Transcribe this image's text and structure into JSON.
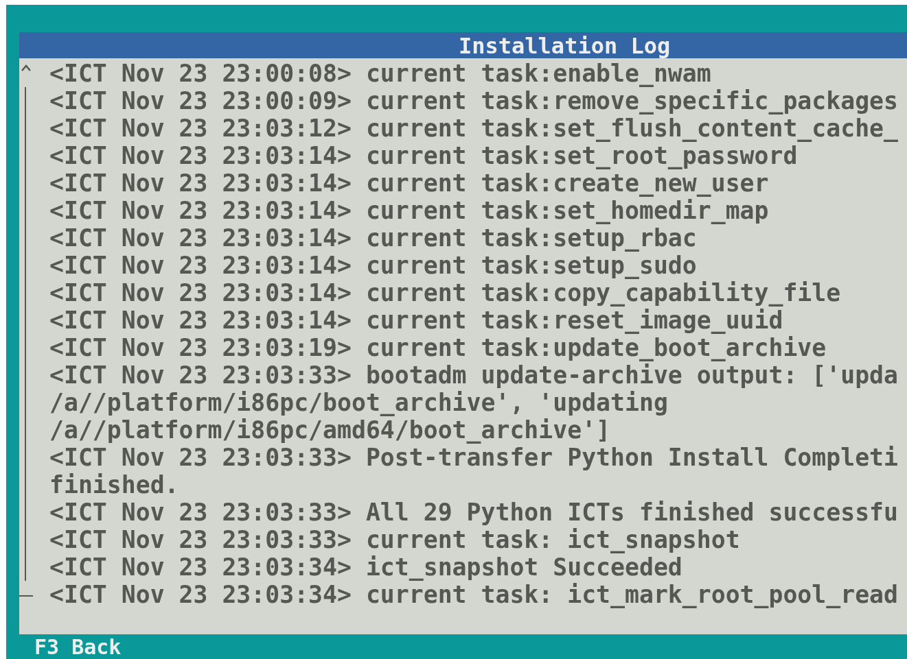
{
  "window": {
    "title": "Installation Log"
  },
  "log_lines": [
    "<ICT Nov 23 23:00:08> current task:enable_nwam",
    "<ICT Nov 23 23:00:09> current task:remove_specific_packages",
    "<ICT Nov 23 23:03:12> current task:set_flush_content_cache_",
    "<ICT Nov 23 23:03:14> current task:set_root_password",
    "<ICT Nov 23 23:03:14> current task:create_new_user",
    "<ICT Nov 23 23:03:14> current task:set_homedir_map",
    "<ICT Nov 23 23:03:14> current task:setup_rbac",
    "<ICT Nov 23 23:03:14> current task:setup_sudo",
    "<ICT Nov 23 23:03:14> current task:copy_capability_file",
    "<ICT Nov 23 23:03:14> current task:reset_image_uuid",
    "<ICT Nov 23 23:03:19> current task:update_boot_archive",
    "<ICT Nov 23 23:03:33> bootadm update-archive output: ['upda",
    "/a//platform/i86pc/boot_archive', 'updating",
    "/a//platform/i86pc/amd64/boot_archive']",
    "<ICT Nov 23 23:03:33> Post-transfer Python Install Completi",
    "finished.",
    "<ICT Nov 23 23:03:33> All 29 Python ICTs finished successfu",
    "<ICT Nov 23 23:03:33> current task: ict_snapshot",
    "<ICT Nov 23 23:03:34> ict_snapshot Succeeded",
    "<ICT Nov 23 23:03:34> current task: ict_mark_root_pool_read"
  ],
  "footer_keys": [
    {
      "key": "F3",
      "label": "Back"
    }
  ]
}
